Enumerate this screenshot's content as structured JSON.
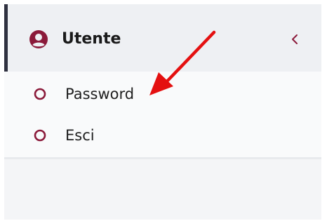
{
  "menu": {
    "header": {
      "title": "Utente",
      "icon": "user-circle-icon",
      "collapse_icon": "chevron-left-icon"
    },
    "items": [
      {
        "label": "Password",
        "icon": "circle-outline-icon"
      },
      {
        "label": "Esci",
        "icon": "circle-outline-icon"
      }
    ]
  },
  "annotation": {
    "type": "red-arrow",
    "points_to": "Password"
  },
  "colors": {
    "accent": "#8b1a3a",
    "annotation": "#e41010",
    "header_bg": "#eef0f3",
    "header_bar": "#2f3140"
  }
}
